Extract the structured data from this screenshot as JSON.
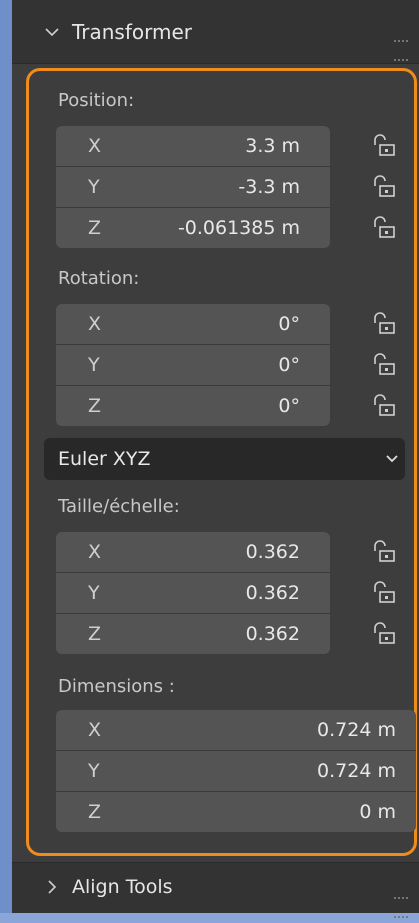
{
  "panel": {
    "title": "Transformer",
    "footer_title": "Align Tools"
  },
  "position": {
    "label": "Position:",
    "x": {
      "axis": "X",
      "value": "3.3 m"
    },
    "y": {
      "axis": "Y",
      "value": "-3.3 m"
    },
    "z": {
      "axis": "Z",
      "value": "-0.061385 m"
    }
  },
  "rotation": {
    "label": "Rotation:",
    "x": {
      "axis": "X",
      "value": "0°"
    },
    "y": {
      "axis": "Y",
      "value": "0°"
    },
    "z": {
      "axis": "Z",
      "value": "0°"
    },
    "mode": "Euler XYZ"
  },
  "scale": {
    "label": "Taille/échelle:",
    "x": {
      "axis": "X",
      "value": "0.362"
    },
    "y": {
      "axis": "Y",
      "value": "0.362"
    },
    "z": {
      "axis": "Z",
      "value": "0.362"
    }
  },
  "dimensions": {
    "label": "Dimensions :",
    "x": {
      "axis": "X",
      "value": "0.724 m"
    },
    "y": {
      "axis": "Y",
      "value": "0.724 m"
    },
    "z": {
      "axis": "Z",
      "value": "0 m"
    }
  },
  "colors": {
    "panel_bg": "#3d3d3d",
    "field_bg": "#545454",
    "highlight": "#f08c1c",
    "desktop_bg": "#8aa6d8"
  }
}
